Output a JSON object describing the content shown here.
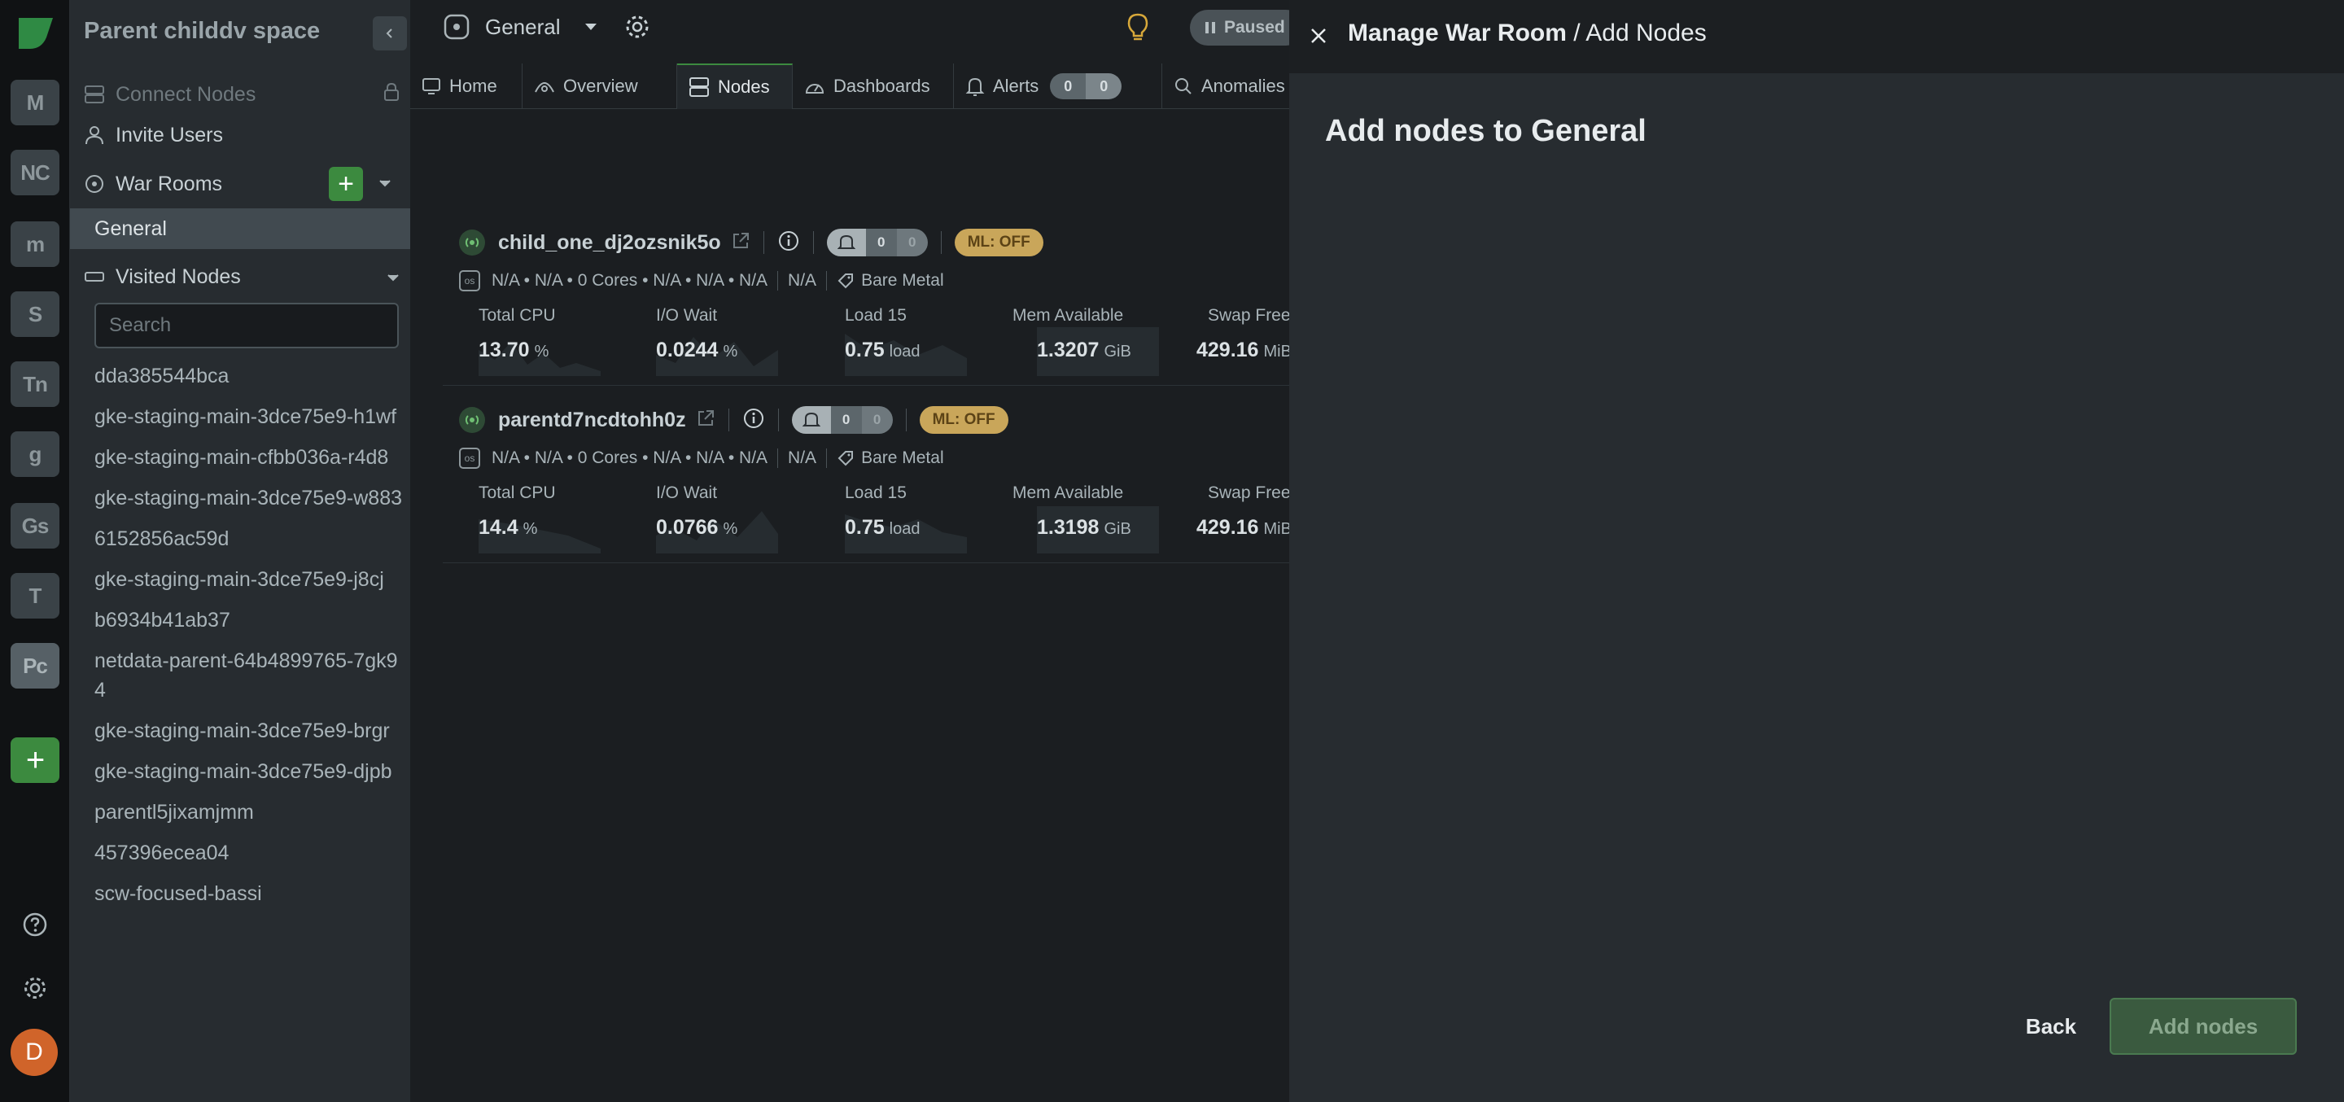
{
  "rail": {
    "spaces": [
      {
        "initials": "M"
      },
      {
        "initials": "NC"
      },
      {
        "initials": "m"
      },
      {
        "initials": "S"
      },
      {
        "initials": "Tn"
      },
      {
        "initials": "g"
      },
      {
        "initials": "Gs"
      },
      {
        "initials": "T"
      },
      {
        "initials": "Pc"
      }
    ],
    "add_label": "+",
    "avatar_initial": "D"
  },
  "sidebar": {
    "space_title": "Parent childdv space",
    "connect_nodes": "Connect Nodes",
    "invite_users": "Invite Users",
    "war_rooms": "War Rooms",
    "war_room_active": "General",
    "visited_nodes": "Visited Nodes",
    "search_placeholder": "Search",
    "nodes": [
      "dda385544bca",
      "gke-staging-main-3dce75e9-h1wf",
      "gke-staging-main-cfbb036a-r4d8",
      "gke-staging-main-3dce75e9-w883",
      "6152856ac59d",
      "gke-staging-main-3dce75e9-j8cj",
      "b6934b41ab37",
      "netdata-parent-64b4899765-7gk94",
      "gke-staging-main-3dce75e9-brgr",
      "gke-staging-main-3dce75e9-djpb",
      "parentl5jixamjmm",
      "457396ecea04",
      "scw-focused-bassi"
    ]
  },
  "main": {
    "room_name": "General",
    "paused_label": "Paused",
    "tabs": {
      "home": "Home",
      "overview": "Overview",
      "nodes": "Nodes",
      "dashboards": "Dashboards",
      "alerts": "Alerts",
      "alerts_critical": "0",
      "alerts_warning": "0",
      "anomalies": "Anomalies"
    },
    "node_cards": [
      {
        "name": "child_one_dj2ozsnik5o",
        "alerts_critical": "0",
        "alerts_warning": "0",
        "ml": "ML: OFF",
        "info": "N/A • N/A • 0 Cores • N/A • N/A • N/A",
        "na": "N/A",
        "type": "Bare Metal",
        "metrics": [
          {
            "label": "Total CPU",
            "value": "13.70",
            "unit": "%"
          },
          {
            "label": "I/O Wait",
            "value": "0.0244",
            "unit": "%"
          },
          {
            "label": "Load 15",
            "value": "0.75",
            "unit": "load"
          },
          {
            "label": "Mem Available",
            "value": "1.3207",
            "unit": "GiB"
          },
          {
            "label": "Swap Free",
            "value": "429.16",
            "unit": "MiB"
          }
        ]
      },
      {
        "name": "parentd7ncdtohh0z",
        "alerts_critical": "0",
        "alerts_warning": "0",
        "ml": "ML: OFF",
        "info": "N/A • N/A • 0 Cores • N/A • N/A • N/A",
        "na": "N/A",
        "type": "Bare Metal",
        "metrics": [
          {
            "label": "Total CPU",
            "value": "14.4",
            "unit": "%"
          },
          {
            "label": "I/O Wait",
            "value": "0.0766",
            "unit": "%"
          },
          {
            "label": "Load 15",
            "value": "0.75",
            "unit": "load"
          },
          {
            "label": "Mem Available",
            "value": "1.3198",
            "unit": "GiB"
          },
          {
            "label": "Swap Free",
            "value": "429.16",
            "unit": "MiB"
          }
        ]
      }
    ]
  },
  "panel": {
    "title_bold": "Manage War Room",
    "title_rest": " / Add Nodes",
    "heading": "Add nodes to General",
    "back": "Back",
    "add_nodes": "Add nodes"
  },
  "colors": {
    "accent_green": "#3c8a3f",
    "ml_off": "#c9a65a",
    "rail_bg": "#101214",
    "sidebar_bg": "#272c30",
    "main_bg": "#1b1e21"
  }
}
